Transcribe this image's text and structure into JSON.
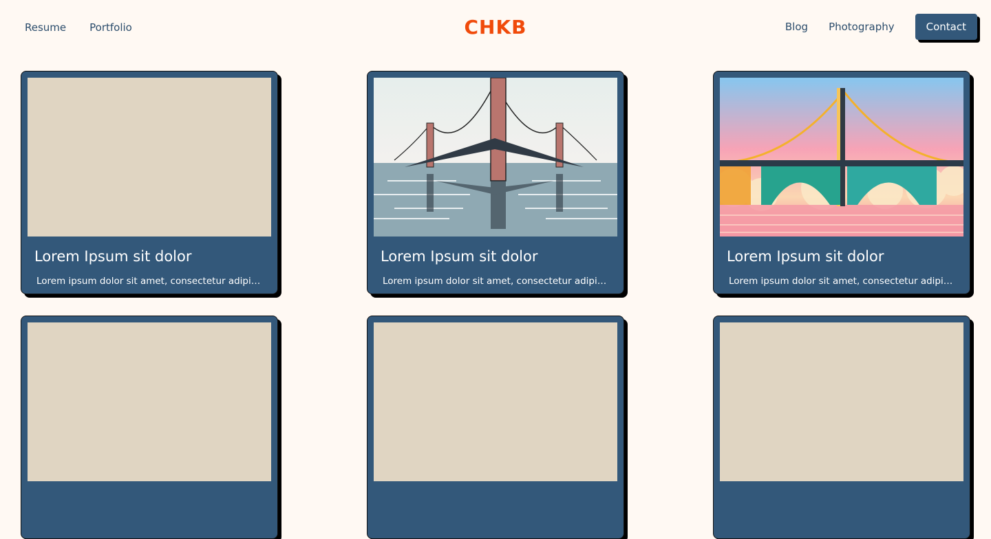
{
  "nav": {
    "left": [
      "Resume",
      "Portfolio"
    ],
    "right": [
      "Blog",
      "Photography"
    ],
    "contact_label": "Contact"
  },
  "logo": {
    "text": "CHKB",
    "color": "#f04a0a"
  },
  "colors": {
    "card": "#33587a",
    "placeholder": "#e0d5c2",
    "background": "#fff9f3"
  },
  "cards": [
    {
      "title": "Lorem Ipsum sit dolor",
      "desc": "Lorem ipsum dolor sit amet, consectetur adipiscing elit",
      "image": "placeholder"
    },
    {
      "title": "Lorem Ipsum sit dolor",
      "desc": "Lorem ipsum dolor sit amet, consectetur adipiscing elit",
      "image": "bridge-gray"
    },
    {
      "title": "Lorem Ipsum sit dolor",
      "desc": "Lorem ipsum dolor sit amet, consectetur adipiscing elit",
      "image": "bridge-sunset"
    },
    {
      "title": "",
      "desc": "",
      "image": "placeholder"
    },
    {
      "title": "",
      "desc": "",
      "image": "placeholder"
    },
    {
      "title": "",
      "desc": "",
      "image": "placeholder"
    }
  ]
}
